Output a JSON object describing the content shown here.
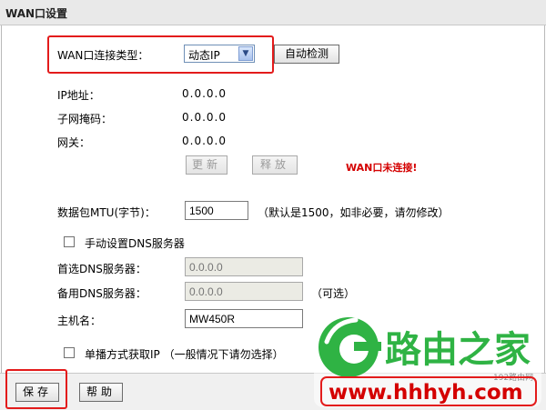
{
  "header": {
    "title": "WAN口设置"
  },
  "connection": {
    "label": "WAN口连接类型：",
    "selected": "动态IP",
    "auto_detect": "自动检测"
  },
  "ip": {
    "label": "IP地址：",
    "value": "0.0.0.0"
  },
  "mask": {
    "label": "子网掩码：",
    "value": "0.0.0.0"
  },
  "gateway": {
    "label": "网关：",
    "value": "0.0.0.0"
  },
  "actions": {
    "renew": "更新",
    "release": "释放",
    "status": "WAN口未连接!"
  },
  "mtu": {
    "label": "数据包MTU(字节)：",
    "value": "1500",
    "hint": "（默认是1500，如非必要，请勿修改）"
  },
  "manual_dns": {
    "label": "手动设置DNS服务器"
  },
  "primary_dns": {
    "label": "首选DNS服务器：",
    "placeholder": "0.0.0.0"
  },
  "secondary_dns": {
    "label": "备用DNS服务器：",
    "placeholder": "0.0.0.0",
    "hint": "（可选）"
  },
  "hostname": {
    "label": "主机名：",
    "value": "MW450R"
  },
  "unicast": {
    "label": "单播方式获取IP （一般情况下请勿选择）"
  },
  "footer": {
    "save": "保存",
    "help": "帮助"
  },
  "watermark": {
    "brand": "路由之家",
    "url": "www.hhhyh.com",
    "small": "192路由网"
  },
  "colors": {
    "highlight": "#e31b1b",
    "status": "#d40000",
    "brand_green": "#2fb344"
  }
}
